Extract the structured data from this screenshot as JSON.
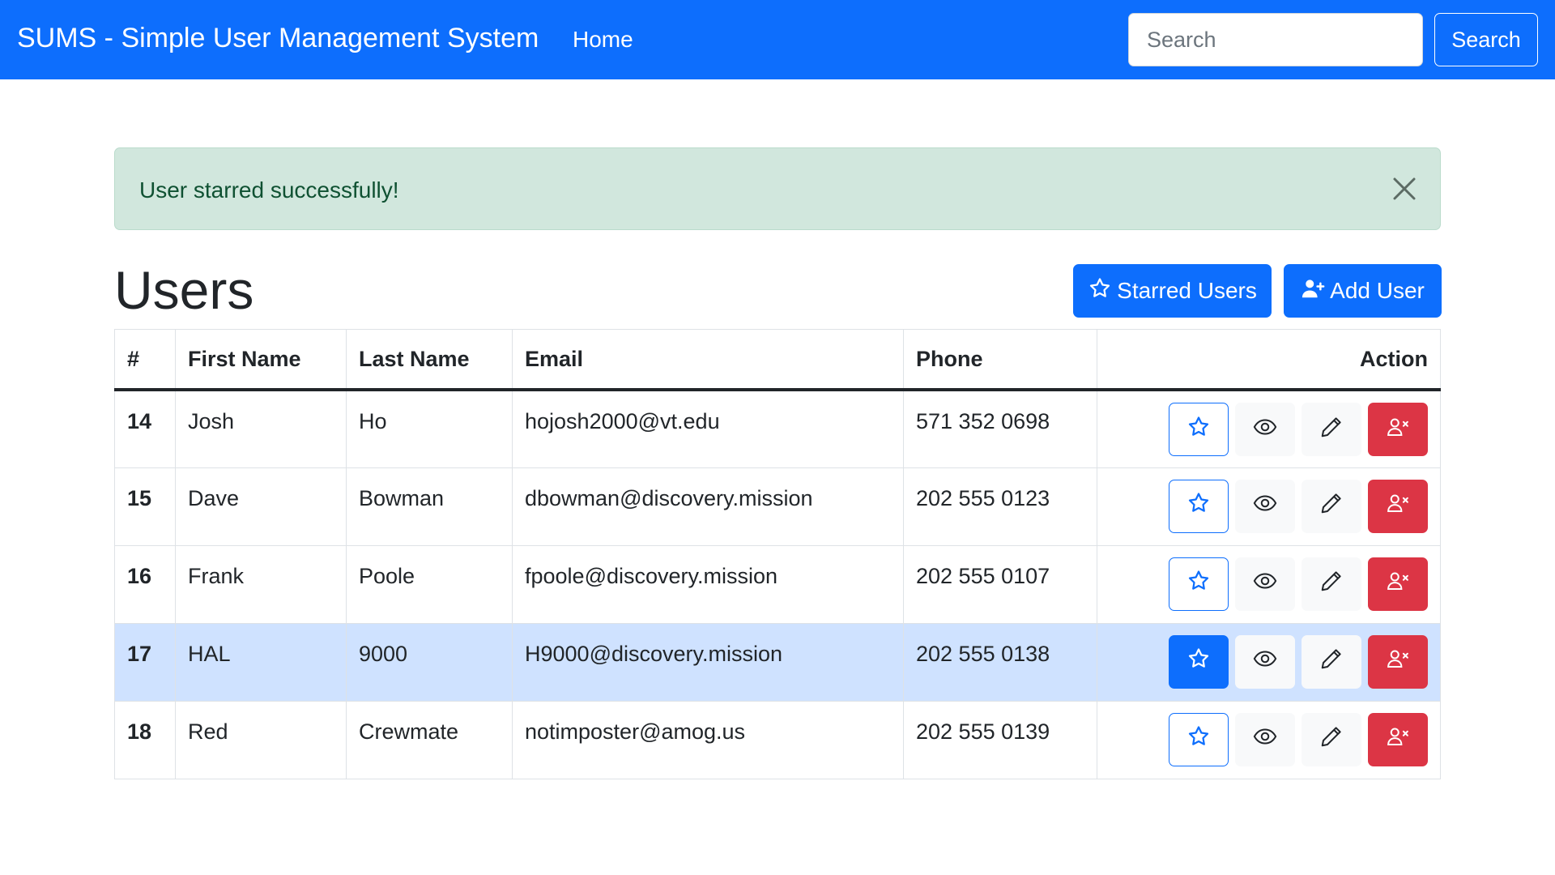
{
  "navbar": {
    "brand": "SUMS - Simple User Management System",
    "home": "Home",
    "search_placeholder": "Search",
    "search_button": "Search"
  },
  "alert": {
    "message": "User starred successfully!"
  },
  "page": {
    "title": "Users",
    "starred_button": "Starred Users",
    "add_button": "Add User"
  },
  "table": {
    "headers": [
      "#",
      "First Name",
      "Last Name",
      "Email",
      "Phone",
      "Action"
    ],
    "rows": [
      {
        "id": "14",
        "first": "Josh",
        "last": "Ho",
        "email": "hojosh2000@vt.edu",
        "phone": "571 352 0698",
        "starred": false
      },
      {
        "id": "15",
        "first": "Dave",
        "last": "Bowman",
        "email": "dbowman@discovery.mission",
        "phone": "202 555 0123",
        "starred": false
      },
      {
        "id": "16",
        "first": "Frank",
        "last": "Poole",
        "email": "fpoole@discovery.mission",
        "phone": "202 555 0107",
        "starred": false
      },
      {
        "id": "17",
        "first": "HAL",
        "last": "9000",
        "email": "H9000@discovery.mission",
        "phone": "202 555 0138",
        "starred": true
      },
      {
        "id": "18",
        "first": "Red",
        "last": "Crewmate",
        "email": "notimposter@amog.us",
        "phone": "202 555 0139",
        "starred": false
      }
    ]
  },
  "colors": {
    "primary": "#0d6efd",
    "danger": "#dc3545",
    "alert_bg": "#d1e7dd",
    "alert_text": "#0f5132",
    "active_row": "#cfe2ff"
  },
  "icons": {
    "star": "star-icon",
    "view": "eye-icon",
    "edit": "pencil-icon",
    "delete": "person-x-icon",
    "add": "person-plus-icon",
    "close": "close-icon"
  }
}
